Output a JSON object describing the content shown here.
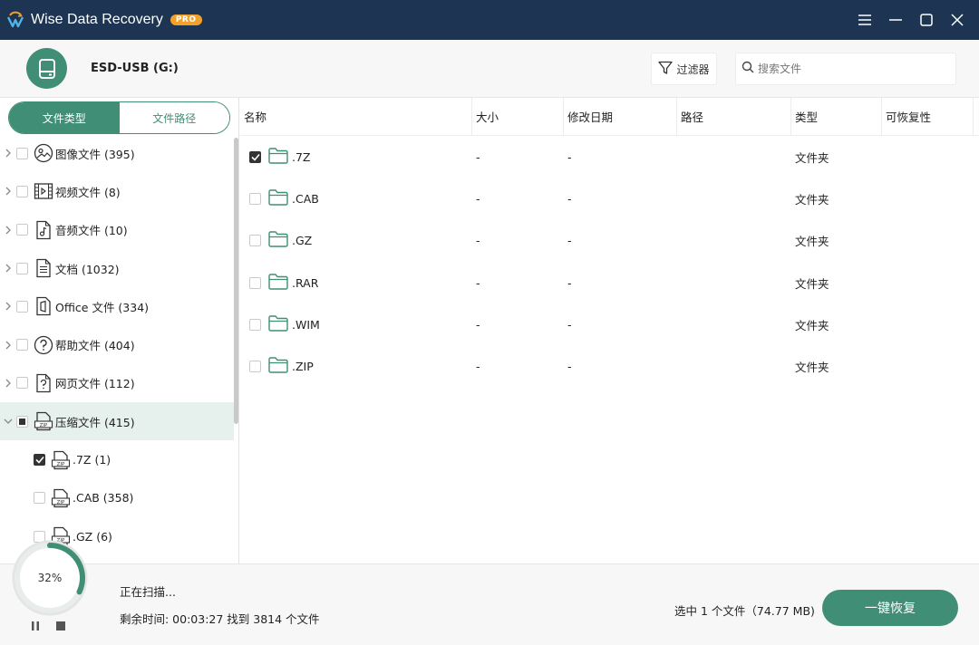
{
  "app": {
    "title": "Wise Data Recovery",
    "badge": "PRO"
  },
  "header": {
    "drive_name": "ESD-USB (G:)",
    "filter_label": "过滤器",
    "search_placeholder": "搜索文件"
  },
  "tabs": [
    {
      "label": "文件类型",
      "active": true
    },
    {
      "label": "文件路径",
      "active": false
    }
  ],
  "tree": [
    {
      "label": "图像文件 (395)",
      "icon": "image-file-icon",
      "expanded": false,
      "checked": "none"
    },
    {
      "label": "视频文件 (8)",
      "icon": "video-file-icon",
      "expanded": false,
      "checked": "none"
    },
    {
      "label": "音频文件 (10)",
      "icon": "audio-file-icon",
      "expanded": false,
      "checked": "none"
    },
    {
      "label": "文档 (1032)",
      "icon": "document-file-icon",
      "expanded": false,
      "checked": "none"
    },
    {
      "label": "Office 文件 (334)",
      "icon": "office-file-icon",
      "expanded": false,
      "checked": "none"
    },
    {
      "label": "帮助文件 (404)",
      "icon": "help-file-icon",
      "expanded": false,
      "checked": "none"
    },
    {
      "label": "网页文件 (112)",
      "icon": "web-file-icon",
      "expanded": false,
      "checked": "none"
    },
    {
      "label": "压缩文件 (415)",
      "icon": "zip-file-icon",
      "expanded": true,
      "checked": "partial"
    }
  ],
  "tree_children": [
    {
      "label": ".7Z (1)",
      "checked": "checked"
    },
    {
      "label": ".CAB (358)",
      "checked": "none"
    },
    {
      "label": ".GZ (6)",
      "checked": "none"
    }
  ],
  "table": {
    "columns": [
      "名称",
      "大小",
      "修改日期",
      "路径",
      "类型",
      "可恢复性"
    ],
    "rows": [
      {
        "name": ".7Z",
        "size": "-",
        "date": "-",
        "path": "",
        "type": "文件夹",
        "recoverability": "",
        "checked": true
      },
      {
        "name": ".CAB",
        "size": "-",
        "date": "-",
        "path": "",
        "type": "文件夹",
        "recoverability": "",
        "checked": false
      },
      {
        "name": ".GZ",
        "size": "-",
        "date": "-",
        "path": "",
        "type": "文件夹",
        "recoverability": "",
        "checked": false
      },
      {
        "name": ".RAR",
        "size": "-",
        "date": "-",
        "path": "",
        "type": "文件夹",
        "recoverability": "",
        "checked": false
      },
      {
        "name": ".WIM",
        "size": "-",
        "date": "-",
        "path": "",
        "type": "文件夹",
        "recoverability": "",
        "checked": false
      },
      {
        "name": ".ZIP",
        "size": "-",
        "date": "-",
        "path": "",
        "type": "文件夹",
        "recoverability": "",
        "checked": false
      }
    ]
  },
  "status": {
    "progress_percent": 32,
    "progress_label": "32%",
    "scanning_text": "正在扫描...",
    "remaining_text": "剩余时间: 00:03:27 找到 3814 个文件",
    "selection_text": "选中 1 个文件（74.77 MB)",
    "recover_label": "一键恢复"
  },
  "colors": {
    "accent": "#3f8e75",
    "titlebar": "#1d3453",
    "badge": "#f2a22a"
  }
}
